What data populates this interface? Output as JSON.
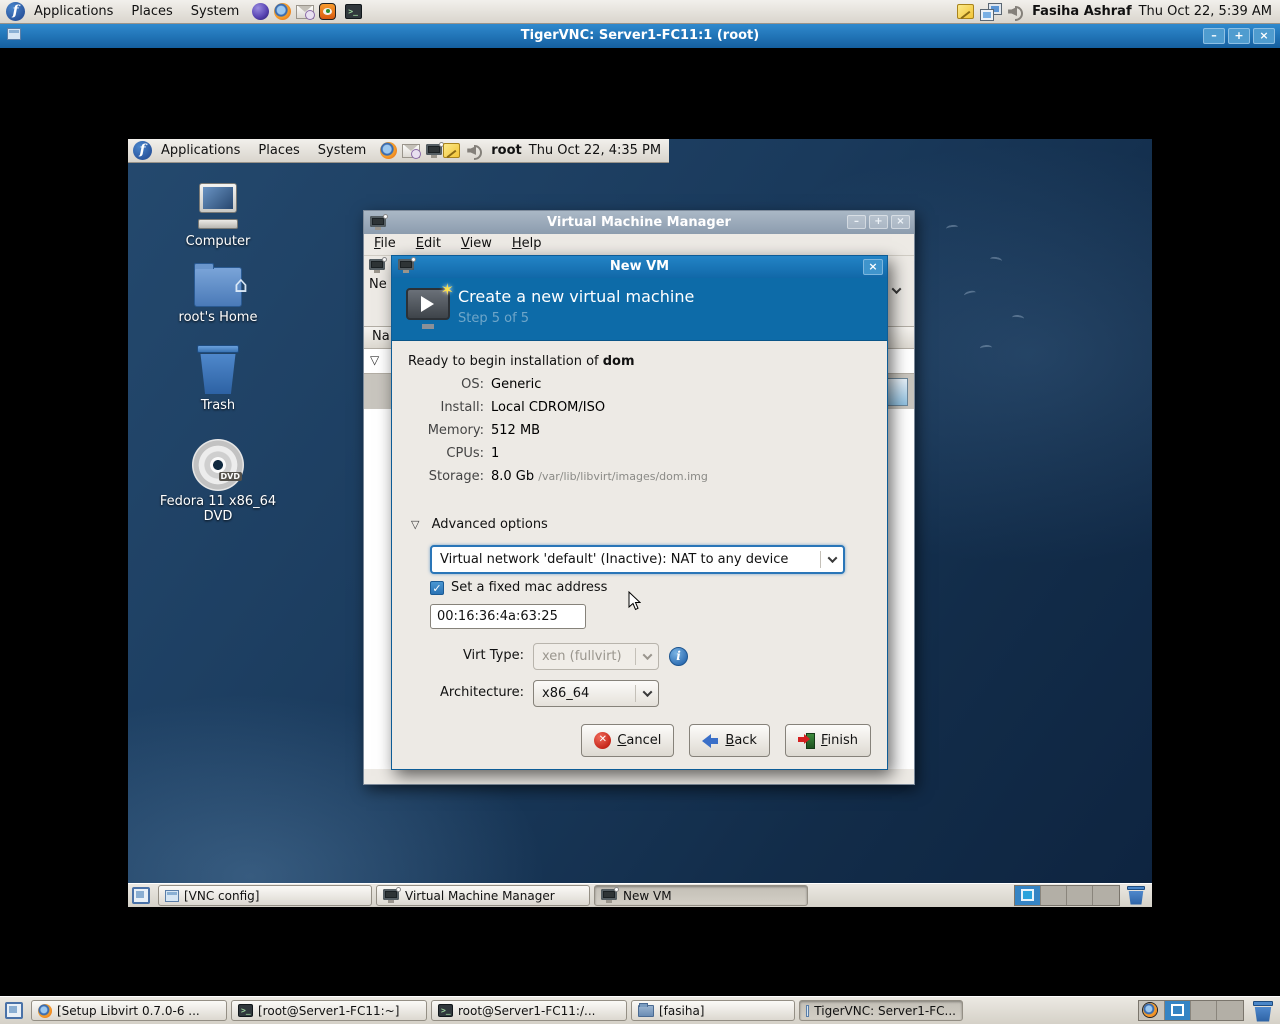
{
  "host_panel": {
    "menus": [
      "Applications",
      "Places",
      "System"
    ],
    "username": "Fasiha Ashraf",
    "clock": "Thu Oct 22, 5:39 AM"
  },
  "vnc_window": {
    "title": "TigerVNC: Server1-FC11:1 (root)"
  },
  "remote_panel": {
    "menus": [
      "Applications",
      "Places",
      "System"
    ],
    "username": "root",
    "clock": "Thu Oct 22, 4:35 PM"
  },
  "desktop_icons": [
    "Computer",
    "root's Home",
    "Trash",
    "Fedora 11 x86_64 DVD"
  ],
  "vmm_window": {
    "title": "Virtual Machine Manager",
    "menus": [
      "File",
      "Edit",
      "View",
      "Help"
    ],
    "toolbar_new_partial": "Ne",
    "name_column_partial": "Na",
    "expander_glyph": "▽"
  },
  "dialog": {
    "title": "New VM",
    "header_title": "Create a new virtual machine",
    "header_step": "Step 5 of 5",
    "ready_prefix": "Ready to begin installation of",
    "vm_name": "dom",
    "summary": [
      {
        "label": "OS:",
        "value": "Generic"
      },
      {
        "label": "Install:",
        "value": "Local CDROM/ISO"
      },
      {
        "label": "Memory:",
        "value": "512 MB"
      },
      {
        "label": "CPUs:",
        "value": "1"
      },
      {
        "label": "Storage:",
        "value": "8.0 Gb",
        "path": "/var/lib/libvirt/images/dom.img"
      }
    ],
    "advanced_label": "Advanced options",
    "network_value": "Virtual network 'default' (Inactive): NAT to any device",
    "mac_checkbox_label": "Set a fixed mac address",
    "mac_checked_glyph": "✓",
    "mac_value": "00:16:36:4a:63:25",
    "virt_type_label": "Virt Type:",
    "virt_type_value": "xen (fullvirt)",
    "info_glyph": "i",
    "arch_label": "Architecture:",
    "arch_value": "x86_64",
    "buttons": {
      "cancel": "Cancel",
      "back": "Back",
      "finish": "Finish"
    }
  },
  "remote_taskbar": {
    "buttons": [
      {
        "label": "[VNC config]"
      },
      {
        "label": "Virtual Machine Manager"
      },
      {
        "label": "New VM"
      }
    ]
  },
  "host_taskbar": {
    "buttons": [
      {
        "label": "[Setup Libvirt 0.7.0-6 ..."
      },
      {
        "label": "[root@Server1-FC11:~]"
      },
      {
        "label": "root@Server1-FC11:/..."
      },
      {
        "label": "[fasiha]"
      },
      {
        "label": "TigerVNC: Server1-FC..."
      }
    ]
  },
  "window_controls": {
    "minimize": "–",
    "maximize": "+",
    "close": "×"
  },
  "colors": {
    "titlebar_blue": "#1878ba",
    "header_blue": "#0d6ba8",
    "accent_blue": "#3584c4",
    "desktop_navy": "#16334f"
  }
}
